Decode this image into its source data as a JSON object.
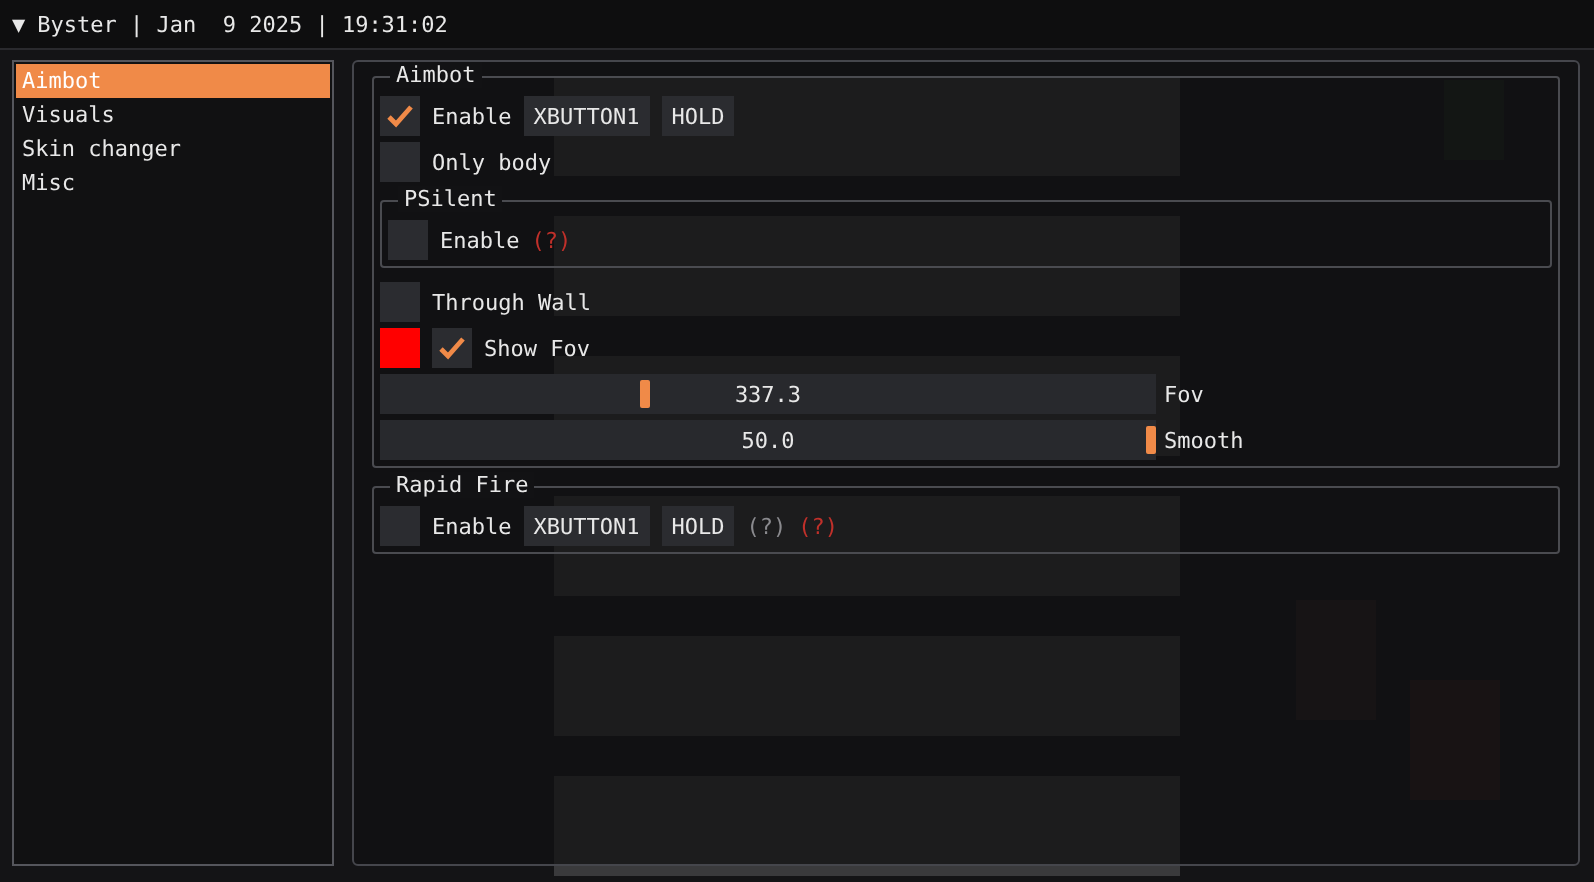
{
  "title_bar": {
    "arrow": "▼",
    "text": "Byster | Jan  9 2025 | 19:31:02"
  },
  "sidebar": {
    "items": [
      {
        "label": "Aimbot",
        "selected": true
      },
      {
        "label": "Visuals",
        "selected": false
      },
      {
        "label": "Skin changer",
        "selected": false
      },
      {
        "label": "Misc",
        "selected": false
      }
    ]
  },
  "groups": [
    {
      "title": "Aimbot",
      "rows": [
        {
          "kind": "checkbox",
          "label": "Enable",
          "checked": true,
          "keybind": "XBUTTON1",
          "mode": "HOLD"
        },
        {
          "kind": "checkbox",
          "label": "Only body",
          "checked": false
        },
        {
          "kind": "group",
          "title": "PSilent",
          "rows": [
            {
              "kind": "checkbox",
              "label": "Enable",
              "checked": false,
              "hints": [
                {
                  "text": "(?)",
                  "kind": "warning"
                }
              ]
            }
          ]
        },
        {
          "kind": "checkbox",
          "label": "Through Wall",
          "checked": false
        },
        {
          "kind": "checkbox",
          "label": "Show Fov",
          "checked": true,
          "color": "#ff0000"
        },
        {
          "kind": "slider",
          "value": "337.3",
          "label": "Fov",
          "level": 0.34
        },
        {
          "kind": "slider",
          "value": "50.0",
          "label": "Smooth",
          "level": 1
        }
      ]
    },
    {
      "title": "Rapid Fire",
      "rows": [
        {
          "kind": "checkbox",
          "label": "Enable",
          "checked": false,
          "keybind": "XBUTTON1",
          "mode": "HOLD",
          "hints": [
            {
              "text": "(?)",
              "kind": "info"
            },
            {
              "text": "(?)",
              "kind": "warning"
            }
          ]
        }
      ]
    }
  ]
}
